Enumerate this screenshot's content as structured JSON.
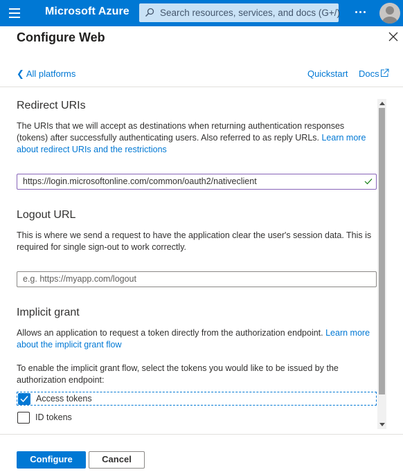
{
  "topbar": {
    "brand": "Microsoft Azure",
    "search_placeholder": "Search resources, services, and docs (G+/)",
    "accent_color": "#0078d4",
    "icons": [
      "hamburger-icon",
      "search-icon",
      "more-icon",
      "avatar"
    ]
  },
  "panel": {
    "title": "Configure Web",
    "back_label": "All platforms",
    "back_chevron": "❮",
    "quickstart_label": "Quickstart",
    "docs_label": "Docs"
  },
  "redirect": {
    "title": "Redirect URIs",
    "desc": "The URIs that we will accept as destinations when returning authentication responses (tokens) after successfully authenticating users. Also referred to as reply URLs.",
    "link": "Learn more about redirect URIs and the restrictions",
    "value": "https://login.microsoftonline.com/common/oauth2/nativeclient"
  },
  "logout": {
    "title": "Logout URL",
    "desc": "This is where we send a request to have the application clear the user's session data. This is required for single sign-out to work correctly.",
    "placeholder": "e.g. https://myapp.com/logout"
  },
  "implicit": {
    "title": "Implicit grant",
    "desc": "Allows an application to request a token directly from the authorization endpoint.",
    "link": "Learn more about the implicit grant flow",
    "prompt": "To enable the implicit grant flow, select the tokens you would like to be issued by the authorization endpoint:",
    "access_tokens": {
      "label": "Access tokens",
      "checked": true
    },
    "id_tokens": {
      "label": "ID tokens",
      "checked": false
    }
  },
  "footer": {
    "configure_label": "Configure",
    "cancel_label": "Cancel"
  }
}
